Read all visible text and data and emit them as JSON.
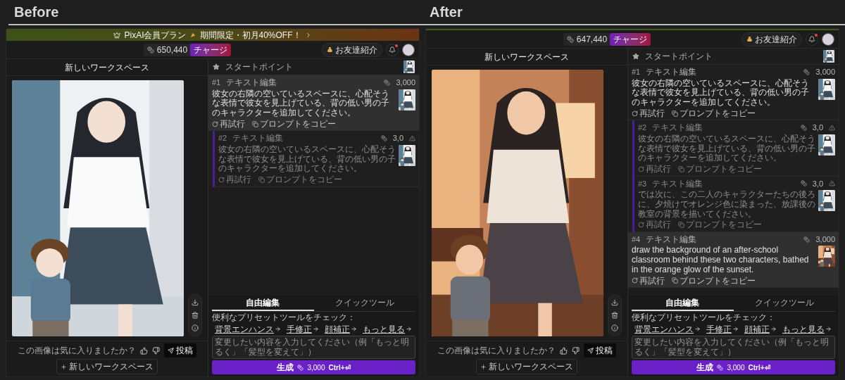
{
  "panels": [
    {
      "label": "Before",
      "banner": {
        "plan": "PixAI会員プラン",
        "offer": "期間限定・初月40%OFF！"
      },
      "credits": "650,440",
      "charge_button": "チャージ",
      "referral_button": "お友達紹介",
      "notification": true,
      "workspace_title": "新しいワークスペース",
      "image": {
        "kind": "picture"
      },
      "start_point": {
        "label": "スタートポイント"
      },
      "history": [
        {
          "number": "#1",
          "title": "テキスト編集",
          "cost": "3,000",
          "prompt": "彼女の右隣の空いているスペースに、心配そうな表情で彼女を見上げている、背の低い男の子のキャラクターを追加してください。",
          "selected": true,
          "disabled": false,
          "actions": [
            "再試行",
            "プロンプトをコピー"
          ],
          "children": [
            {
              "number": "#2",
              "title": "テキスト編集",
              "cost": "3,0",
              "prompt": "彼女の右隣の空いているスペースに、心配そうな表情で彼女を見上げている、背の低い男の子のキャラクターを追加してください。",
              "selected": false,
              "disabled": true,
              "actions": [
                "再試行",
                "プロンプトをコピー"
              ]
            }
          ]
        }
      ],
      "tabs": [
        {
          "label": "自由編集",
          "selected": true
        },
        {
          "label": "クイックツール",
          "selected": false
        }
      ],
      "presets": {
        "heading": "便利なプリセットツールをチェック：",
        "links": [
          "背景エンハンス",
          "手修正",
          "顔補正",
          "もっと見る"
        ]
      },
      "prompt_field": {
        "placeholder": "変更したい内容を入力してください（例「もっと明るく」「髪型を変えて」）"
      },
      "generate_button": {
        "label": "生成",
        "cost": "3,000",
        "shortcut": "Ctrl+⏎"
      },
      "feedback": {
        "question": "この画像は気に入りましたか？",
        "post_button": "投稿",
        "workspace_button": "新しいワークスペース"
      }
    },
    {
      "label": "After",
      "credits": "647,440",
      "charge_button": "チャージ",
      "referral_button": "お友達紹介",
      "notification": true,
      "workspace_title": "新しいワークスペース",
      "image": {
        "kind": "picture"
      },
      "start_point": {
        "label": "スタートポイント"
      },
      "history": [
        {
          "number": "#1",
          "title": "テキスト編集",
          "cost": "3,000",
          "prompt": "彼女の右隣の空いているスペースに、心配そうな表情で彼女を見上げている、背の低い男の子のキャラクターを追加してください。",
          "selected": false,
          "disabled": false,
          "actions": [
            "再試行",
            "プロンプトをコピー"
          ],
          "children": [
            {
              "number": "#2",
              "title": "テキスト編集",
              "cost": "3,0",
              "prompt": "彼女の右隣の空いているスペースに、心配そうな表情で彼女を見上げている、背の低い男の子のキャラクターを追加してください。",
              "selected": false,
              "disabled": true,
              "actions": [
                "再試行",
                "プロンプトをコピー"
              ]
            },
            {
              "number": "#3",
              "title": "テキスト編集",
              "cost": "3,0",
              "prompt": "では次に、この二人のキャラクターたちの後ろに、夕焼けでオレンジ色に染まった、放課後の教室の背景を描いてください。",
              "selected": false,
              "disabled": true,
              "actions": [
                "再試行",
                "プロンプトをコピー"
              ]
            }
          ]
        },
        {
          "number": "#4",
          "title": "テキスト編集",
          "cost": "3,000",
          "prompt": "draw the background of an after-school classroom behind these two characters, bathed in the orange glow of the sunset.",
          "selected": true,
          "disabled": false,
          "actions": [
            "再試行",
            "プロンプトをコピー"
          ]
        }
      ],
      "tabs": [
        {
          "label": "自由編集",
          "selected": true
        },
        {
          "label": "クイックツール",
          "selected": false
        }
      ],
      "presets": {
        "heading": "便利なプリセットツールをチェック：",
        "links": [
          "背景エンハンス",
          "手修正",
          "顔補正",
          "もっと見る"
        ]
      },
      "prompt_field": {
        "placeholder": "変更したい内容を入力してください（例「もっと明るく」「髪型を変えて」）"
      },
      "generate_button": {
        "label": "生成",
        "cost": "3,000",
        "shortcut": "Ctrl+⏎"
      },
      "feedback": {
        "question": "この画像は気に入りましたか？",
        "post_button": "投稿",
        "workspace_button": "新しいワークスペース"
      }
    }
  ]
}
